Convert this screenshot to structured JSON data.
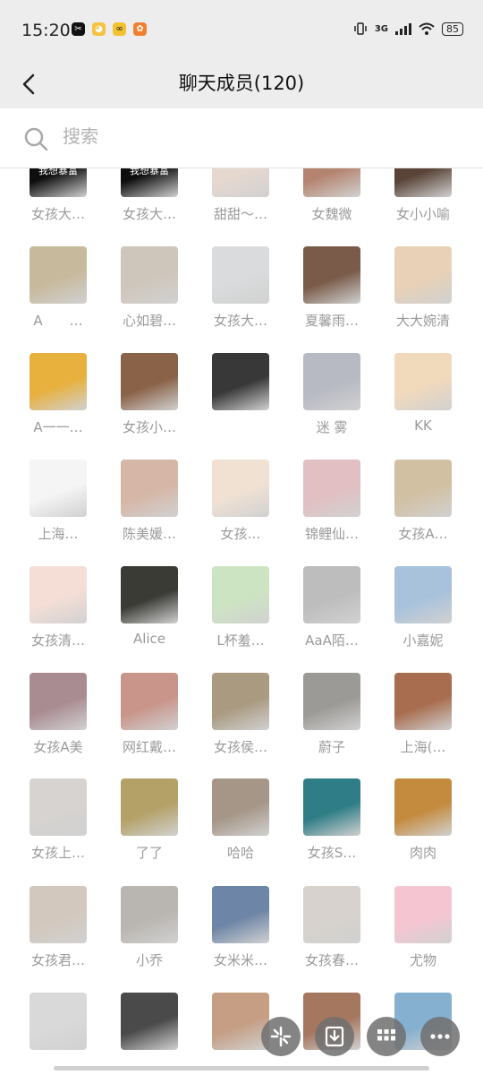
{
  "status": {
    "time": "15:20",
    "network": "3G",
    "battery": "85",
    "notification_icons": [
      "capcut-icon",
      "qq-icon",
      "glasses-app-icon",
      "orange-app-icon"
    ]
  },
  "header": {
    "title": "聊天成员(120)"
  },
  "search": {
    "placeholder": "搜索",
    "value": ""
  },
  "members": [
    {
      "name": "女孩大…",
      "color": "#0e0e0e",
      "text": "我想暴富"
    },
    {
      "name": "女孩大…",
      "color": "#0e0e0e",
      "text": "我想暴富"
    },
    {
      "name": "甜甜～…",
      "color": "#e6d8cf"
    },
    {
      "name": "女魏微",
      "color": "#b58470"
    },
    {
      "name": "女小小喻",
      "color": "#5a4438"
    },
    {
      "name": "A　　…",
      "color": "#c7b99c"
    },
    {
      "name": "心如碧…",
      "color": "#cfc6bb"
    },
    {
      "name": "女孩大…",
      "color": "#d9dbdc"
    },
    {
      "name": "夏馨雨…",
      "color": "#7a5b49"
    },
    {
      "name": "大大婉清",
      "color": "#e8d1b6"
    },
    {
      "name": "A一一…",
      "color": "#e8b03d"
    },
    {
      "name": "女孩小…",
      "color": "#8a6248"
    },
    {
      "name": "",
      "color": "#383838"
    },
    {
      "name": "迷 雾",
      "color": "#b7b9c3"
    },
    {
      "name": "KK",
      "color": "#f1d9bc"
    },
    {
      "name": "上海…",
      "color": "#f5f5f5"
    },
    {
      "name": "陈美媛…",
      "color": "#d6b6a6"
    },
    {
      "name": "女孩…",
      "color": "#f0e1d3"
    },
    {
      "name": "锦鲤仙…",
      "color": "#e2bfc2"
    },
    {
      "name": "女孩A…",
      "color": "#d2c0a3"
    },
    {
      "name": "女孩清…",
      "color": "#f4ded6"
    },
    {
      "name": "Alice",
      "color": "#3b3b36"
    },
    {
      "name": "L杯羞…",
      "color": "#cde4c2"
    },
    {
      "name": "AaA陌…",
      "color": "#bdbdbd"
    },
    {
      "name": "小嘉妮",
      "color": "#a8c2dc"
    },
    {
      "name": "女孩A美",
      "color": "#a98c92"
    },
    {
      "name": "网红戴…",
      "color": "#c9948a"
    },
    {
      "name": "女孩侯…",
      "color": "#a99a80"
    },
    {
      "name": "蔚子",
      "color": "#9c9a96"
    },
    {
      "name": "上海(…",
      "color": "#a86d4f"
    },
    {
      "name": "女孩上…",
      "color": "#d6d3d0"
    },
    {
      "name": "了了",
      "color": "#b4a167"
    },
    {
      "name": "哈哈",
      "color": "#a59687"
    },
    {
      "name": "女孩S…",
      "color": "#2f7d86"
    },
    {
      "name": "肉肉",
      "color": "#c48a3d"
    },
    {
      "name": "女孩君…",
      "color": "#d3c8bd"
    },
    {
      "name": "小乔",
      "color": "#b9b5b0"
    },
    {
      "name": "女米米…",
      "color": "#6d85a6"
    },
    {
      "name": "女孩春…",
      "color": "#d7d2cd"
    },
    {
      "name": "尤物",
      "color": "#f6c5d2"
    },
    {
      "name": "",
      "color": "#d9d9d9"
    },
    {
      "name": "",
      "color": "#4a4a4a"
    },
    {
      "name": "",
      "color": "#c59e84"
    },
    {
      "name": "",
      "color": "#a6775f"
    },
    {
      "name": "",
      "color": "#86b0d0"
    }
  ],
  "fabs": [
    "sparkle-icon",
    "download-icon",
    "grid-icon",
    "more-icon"
  ]
}
